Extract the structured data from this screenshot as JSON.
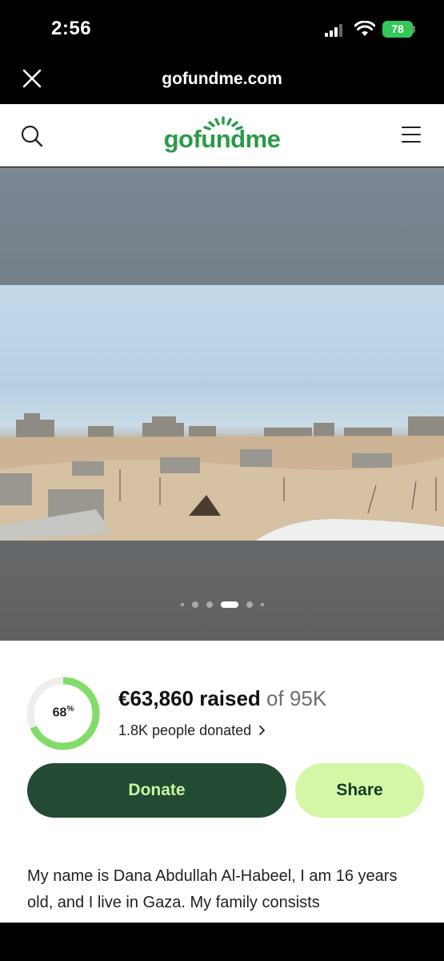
{
  "status_bar": {
    "time": "2:56",
    "battery": "78"
  },
  "browser": {
    "domain": "gofundme.com"
  },
  "site": {
    "logo": "gofundme"
  },
  "hero": {
    "slide_count": 6,
    "active_slide": 3
  },
  "campaign": {
    "percent": "68",
    "percent_value": 0.68,
    "raised_amount": "€63,860 raised",
    "goal_text": "of 95K",
    "donors_text": "1.8K people donated",
    "donate_label": "Donate",
    "share_label": "Share",
    "story_text": "My name is Dana Abdullah Al-Habeel, I am 16 years old, and I live in Gaza. My family consists"
  },
  "colors": {
    "brand_green": "#2b9b4a",
    "donate_bg": "#234a33",
    "share_bg": "#d3f7a6",
    "progress_green": "#82dc6a"
  },
  "icons": [
    "close-icon",
    "search-icon",
    "menu-icon",
    "chevron-right-icon",
    "wifi-icon",
    "signal-icon",
    "battery-icon"
  ]
}
